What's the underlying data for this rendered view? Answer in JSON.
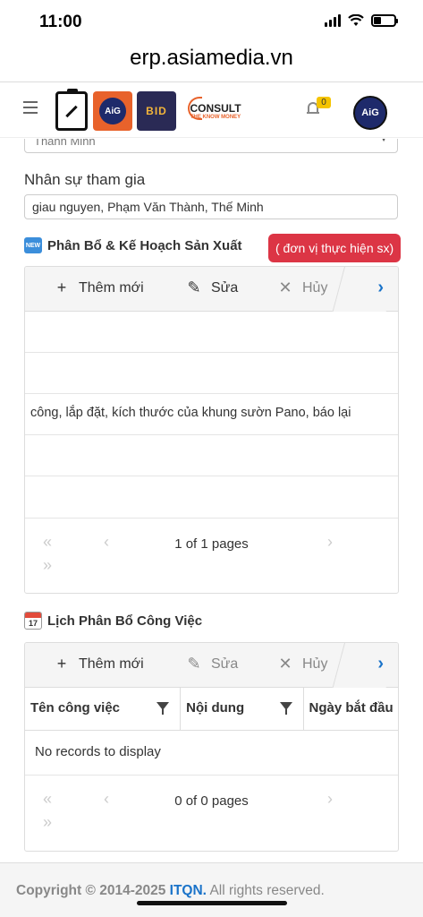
{
  "status_bar": {
    "time": "11:00"
  },
  "browser": {
    "url": "erp.asiamedia.vn"
  },
  "header": {
    "logos": {
      "aig": "AiG",
      "bid": "BID",
      "consult": "CONSULT",
      "consult_sub": "THE KNOW MONEY"
    },
    "notification_count": "0",
    "avatar_text": "AiG"
  },
  "form": {
    "select_partial_value": "Thành Minh",
    "participants_label": "Nhân sự tham gia",
    "participants_value": "giau nguyen, Phạm Văn Thành, Thế Minh"
  },
  "allocation": {
    "new_icon_text": "NEW",
    "title": "Phân Bổ & Kế Hoạch Sản Xuất",
    "tag": "( đơn vị thực hiện sx)",
    "toolbar": {
      "add": "Thêm mới",
      "edit": "Sửa",
      "cancel": "Hủy"
    },
    "rows": [
      "",
      "",
      "công, lắp đặt, kích thước của khung sườn Pano, báo lại",
      "",
      ""
    ],
    "pager_info": "1 of 1 pages"
  },
  "schedule": {
    "cal_icon_text": "17",
    "title": "Lịch Phân Bổ Công Việc",
    "toolbar": {
      "add": "Thêm mới",
      "edit": "Sửa",
      "cancel": "Hủy"
    },
    "columns": [
      "Tên công việc",
      "Nội dung",
      "Ngày bắt đầu"
    ],
    "empty_text": "No records to display",
    "pager_info": "0 of 0 pages"
  },
  "footer": {
    "copyright": "Copyright © 2014-2025 ",
    "brand": "ITQN.",
    "rest": " All rights reserved."
  },
  "colors": {
    "accent": "#1a73c9",
    "tag_red": "#dc3545",
    "badge_yellow": "#f5c400"
  }
}
